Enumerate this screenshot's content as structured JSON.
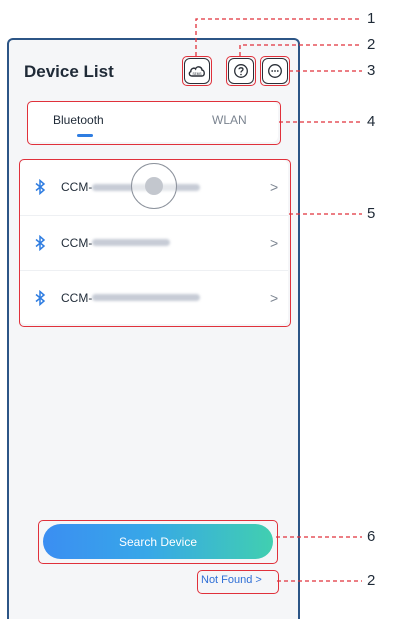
{
  "header": {
    "title": "Device List"
  },
  "header_icons": [
    "cloud-sems-icon",
    "help-icon",
    "more-icon"
  ],
  "cloud_icon_label": "SEMS",
  "tabs": [
    {
      "label": "Bluetooth",
      "active": true
    },
    {
      "label": "WLAN",
      "active": false
    }
  ],
  "devices": [
    {
      "name_prefix": "CCM-",
      "chevron": ">"
    },
    {
      "name_prefix": "CCM-",
      "chevron": ">"
    },
    {
      "name_prefix": "CCM-",
      "chevron": ">"
    }
  ],
  "search_button": {
    "label": "Search Device"
  },
  "not_found_link": {
    "label": "Not Found >"
  },
  "callouts": [
    "1",
    "2",
    "3",
    "4",
    "5",
    "6",
    "2"
  ],
  "colors": {
    "highlight": "#e0313b",
    "accent": "#2f7de1",
    "gradient_start": "#3b8ef2",
    "gradient_end": "#41cfb0"
  }
}
